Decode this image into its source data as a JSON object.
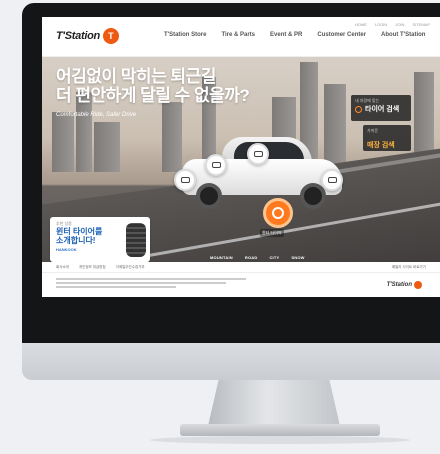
{
  "header": {
    "logo_text": "T'Station",
    "logo_mark": "T",
    "nav": [
      "T'Station Store",
      "Tire & Parts",
      "Event & PR",
      "Customer Center",
      "About T'Station"
    ],
    "util": [
      "HOME",
      "LOGIN",
      "JOIN",
      "SITEMAP"
    ]
  },
  "hero": {
    "headline_line1": "어김없이 막히는 퇴근길",
    "headline_line2": "더 편안하게 달릴 수 없을까?",
    "subline": "Comfortable Ride, Safer Drive",
    "search_small": "내 차량에 맞는",
    "search_big": "타이어 검색",
    "store_small": "가까운",
    "store_big": "매장 검색",
    "main_hotspot_label": "윈터 타이어",
    "scenes": [
      "MOUNTAIN",
      "ROAD",
      "CITY",
      "SNOW"
    ]
  },
  "promo": {
    "tag": "추천 상품",
    "title_line1": "윈터 타이어를",
    "title_line2": "소개합니다!",
    "brand": "HANKOOK"
  },
  "footer": {
    "links": [
      "회사소개",
      "개인정보 취급방침",
      "이메일무단수집거부"
    ],
    "right_link": "패밀리 사이트 바로가기",
    "logo_text": "T'Station"
  },
  "colors": {
    "brand_orange": "#ee5a12",
    "promo_blue": "#1a5fb4"
  }
}
